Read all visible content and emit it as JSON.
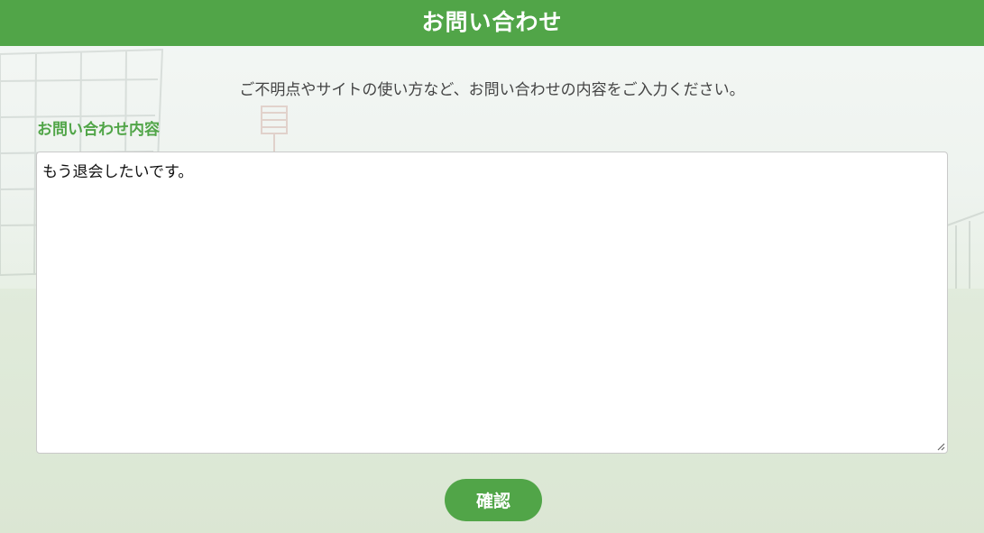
{
  "header": {
    "title": "お問い合わせ"
  },
  "intro": {
    "text": "ご不明点やサイトの使い方など、お問い合わせの内容をご入力ください。"
  },
  "form": {
    "label": "お問い合わせ内容",
    "message_value": "もう退会したいです。",
    "confirm_label": "確認"
  },
  "colors": {
    "accent": "#51a548",
    "label_text": "#51a548",
    "body_text": "#444444"
  },
  "icons": {
    "resize": "resize-grip-icon"
  }
}
